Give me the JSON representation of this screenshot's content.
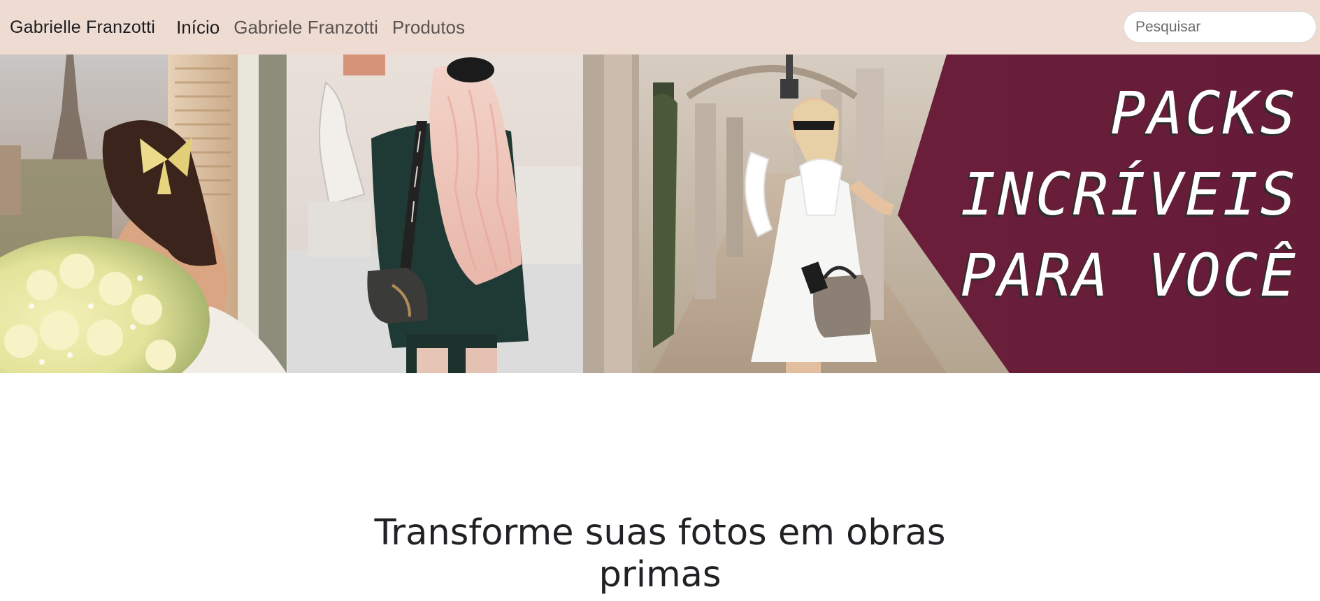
{
  "navbar": {
    "brand": "Gabrielle Franzotti",
    "links": [
      {
        "label": "Início",
        "active": true
      },
      {
        "label": "Gabriele Franzotti",
        "active": false
      },
      {
        "label": "Produtos",
        "active": false
      }
    ],
    "search": {
      "placeholder": "Pesquisar",
      "value": ""
    }
  },
  "hero": {
    "lines": [
      "PACKS",
      "INCRÍVEIS",
      "PARA VOCÊ"
    ],
    "accent_color": "#6e1f3a",
    "panel_images": [
      "woman-with-bow-and-flowers-eiffel-tower",
      "woman-with-long-wavy-hair-and-handbag",
      "woman-in-white-dress-in-arcade"
    ]
  },
  "main": {
    "heading_lines": [
      "Transforme suas fotos em obras",
      "primas"
    ]
  },
  "colors": {
    "navbar_bg": "#eedcd2",
    "text_dark": "#202124",
    "nav_muted": "#5b5452"
  }
}
